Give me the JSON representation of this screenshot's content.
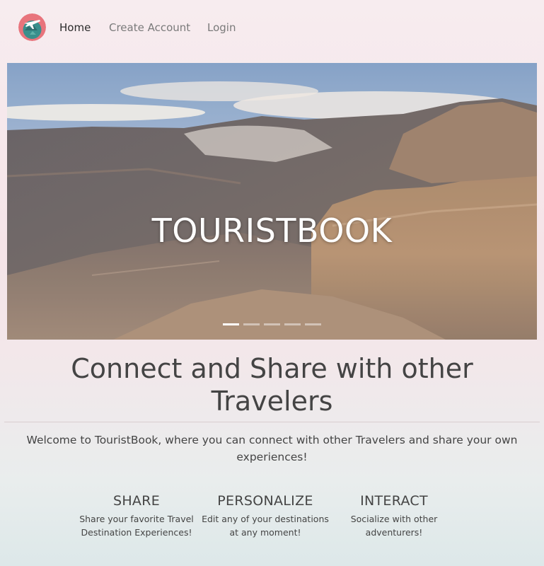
{
  "nav": {
    "logo_icon": "globe-plane-logo-icon",
    "links": [
      {
        "label": "Home",
        "active": true
      },
      {
        "label": "Create Account",
        "active": false
      },
      {
        "label": "Login",
        "active": false
      }
    ]
  },
  "hero": {
    "title": "TOURISTBOOK",
    "image": "canyon-landscape-photo",
    "indicators": {
      "count": 5,
      "active_index": 0
    }
  },
  "main": {
    "headline": "Connect and Share with other Travelers",
    "welcome": "Welcome to TouristBook, where you can connect with other Travelers and share your own experiences!"
  },
  "features": [
    {
      "title": "SHARE",
      "text": "Share your favorite Travel Destination Experiences!"
    },
    {
      "title": "PERSONALIZE",
      "text": "Edit any of your destinations at any moment!"
    },
    {
      "title": "INTERACT",
      "text": "Socialize with other adventurers!"
    }
  ],
  "colors": {
    "logo_circle": "#e8747c",
    "logo_globe": "#3a8f8c",
    "nav_active": "#2b2b2b",
    "nav_inactive": "#7a7a7a",
    "hero_title": "#ffffff"
  }
}
